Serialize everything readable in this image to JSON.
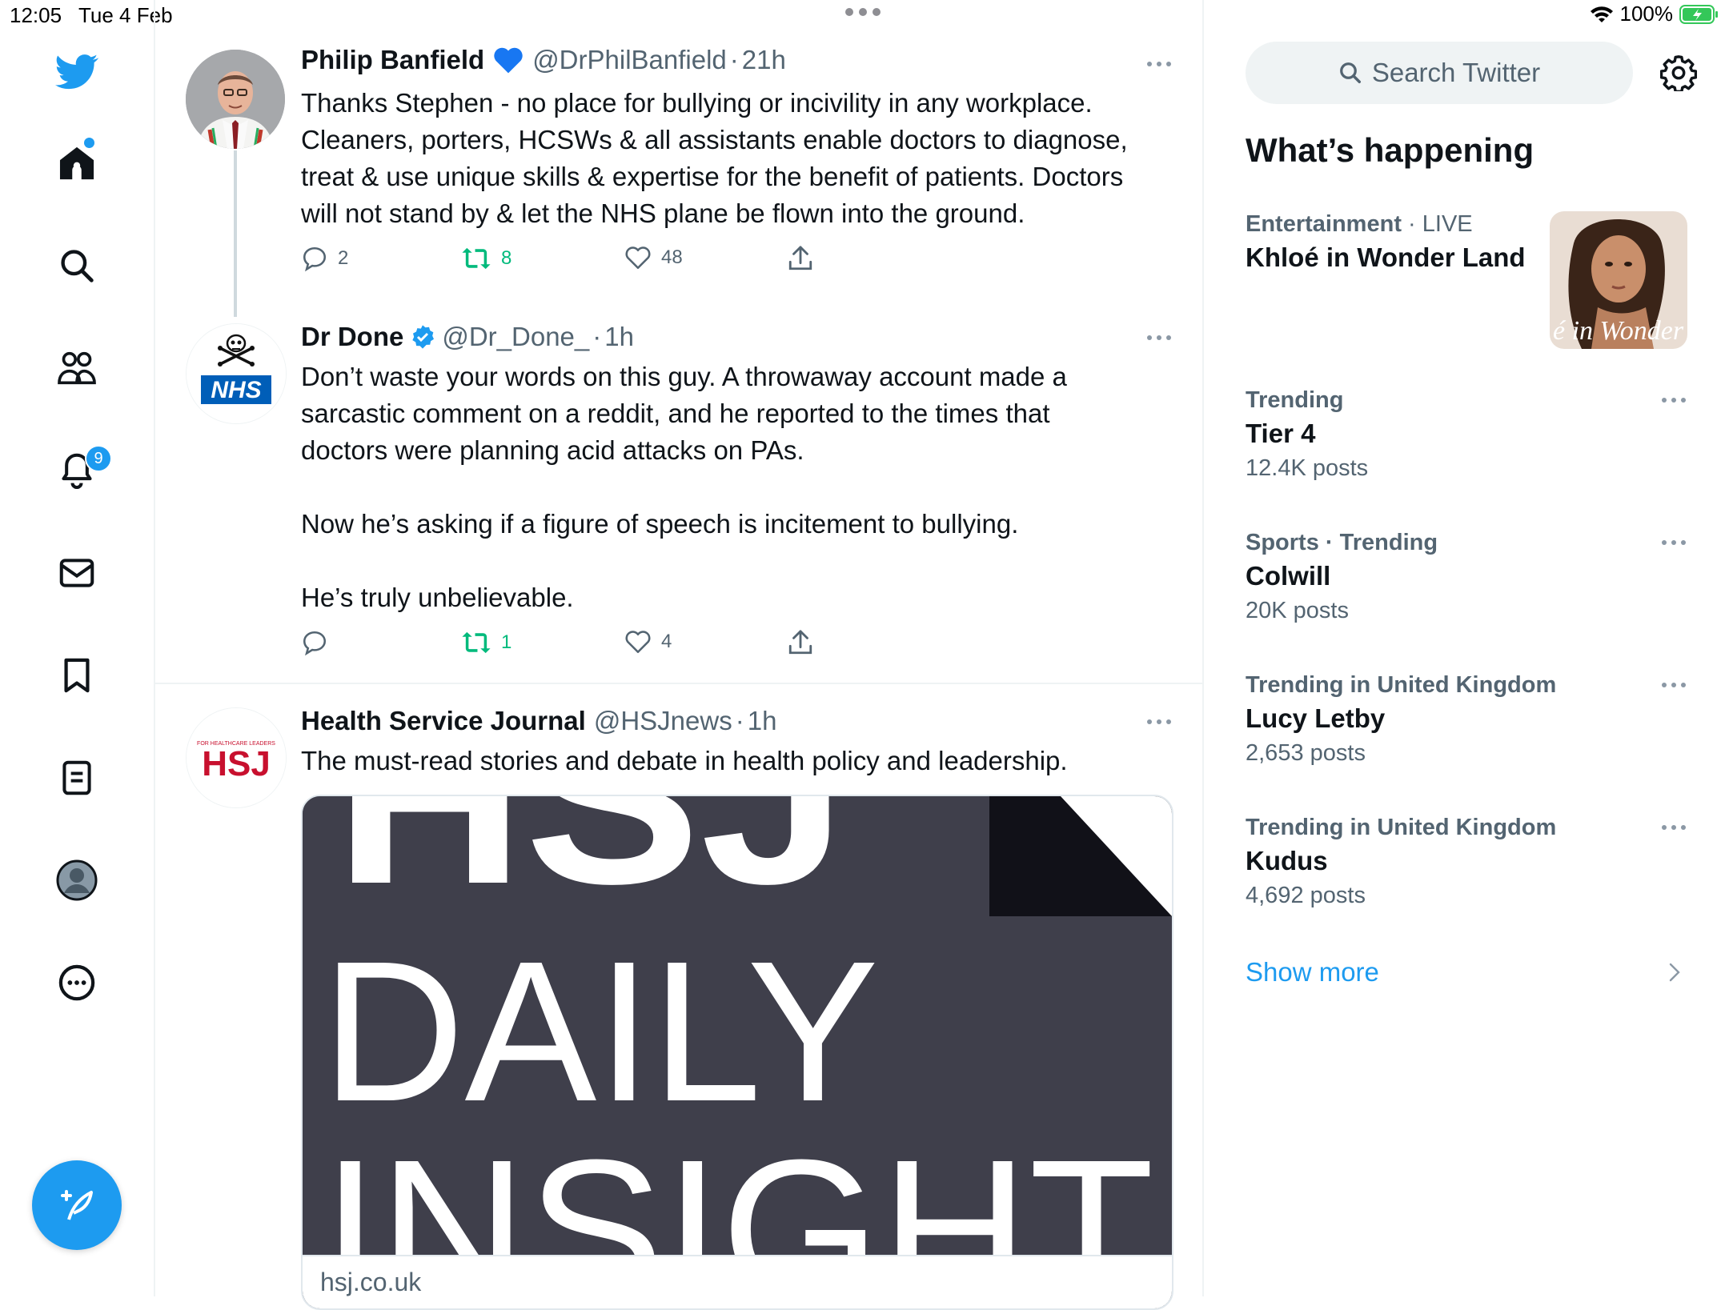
{
  "status_bar": {
    "time": "12:05",
    "date": "Tue 4 Feb",
    "battery": "100%"
  },
  "nav": {
    "notification_count": "9",
    "accent": "#1d9bf0",
    "items": [
      "twitter-logo-icon",
      "home-icon",
      "search-icon",
      "communities-icon",
      "bell-icon",
      "mail-icon",
      "bookmark-icon",
      "lists-icon",
      "profile-icon",
      "more-icon"
    ]
  },
  "tweets": [
    {
      "name": "Philip Banfield",
      "handle": "@DrPhilBanfield",
      "time": "21h",
      "text": [
        "Thanks Stephen - no place for bullying or incivility in any workplace.",
        "Cleaners, porters, HCSWs & all assistants enable doctors to diagnose,",
        "treat & use unique skills & expertise for the benefit of patients. Doctors",
        "will not stand by & let the NHS plane be flown into the ground."
      ],
      "replies": "2",
      "retweets": "8",
      "likes": "48"
    },
    {
      "name": "Dr Done",
      "handle": "@Dr_Done_",
      "time": "1h",
      "avatar_text": "NHS",
      "text": [
        "Don’t waste your words on this guy. A throwaway account made a",
        "sarcastic comment on a reddit, and he reported to the times that",
        "doctors were planning acid attacks on PAs.",
        "",
        "Now he’s asking if a figure of speech is incitement to bullying.",
        "",
        "He’s truly unbelievable."
      ],
      "replies": "",
      "retweets": "1",
      "likes": "4"
    },
    {
      "name": "Health Service Journal",
      "handle": "@HSJnews",
      "time": "1h",
      "avatar_text": "HSJ",
      "avatar_tagline": "FOR HEALTHCARE LEADERS",
      "text": [
        "The must-read stories and debate in health policy and leadership."
      ],
      "card": {
        "headline_1": "HSJ",
        "headline_2": "DAILY",
        "headline_3": "INSIGHT",
        "domain": "hsj.co.uk"
      }
    }
  ],
  "sidebar": {
    "search_placeholder": "Search Twitter",
    "title": "What’s happening",
    "featured": {
      "category": "Entertainment",
      "live": "LIVE",
      "name": "Khloé in Wonder Land",
      "thumb_caption": "é in Wonder l"
    },
    "trends": [
      {
        "category": "Trending",
        "name": "Tier 4",
        "count": "12.4K posts"
      },
      {
        "category": "Sports · Trending",
        "name": "Colwill",
        "count": "20K posts"
      },
      {
        "category": "Trending in United Kingdom",
        "name": "Lucy Letby",
        "count": "2,653 posts"
      },
      {
        "category": "Trending in United Kingdom",
        "name": "Kudus",
        "count": "4,692 posts"
      }
    ],
    "show_more": "Show more"
  }
}
